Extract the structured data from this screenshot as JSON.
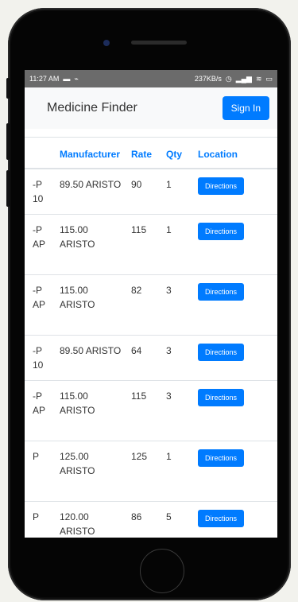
{
  "statusbar": {
    "time": "11:27 AM",
    "speed": "237KB/s"
  },
  "navbar": {
    "brand": "Medicine Finder",
    "signin_label": "Sign In"
  },
  "table": {
    "headers": {
      "name": "",
      "manufacturer": "Manufacturer",
      "rate": "Rate",
      "qty": "Qty",
      "location": "Location"
    },
    "button_label": "Directions",
    "rows": [
      {
        "name_line1": "P-",
        "name_line2": "10",
        "manufacturer": "89.50 ARISTO",
        "rate": "90",
        "qty": "1"
      },
      {
        "name_line1": "P-",
        "name_line2": "AP",
        "manufacturer": "115.00 ARISTO",
        "rate": "115",
        "qty": "1"
      },
      {
        "name_line1": "P-",
        "name_line2": "AP",
        "manufacturer": "115.00 ARISTO",
        "rate": "82",
        "qty": "3"
      },
      {
        "name_line1": "P-",
        "name_line2": "10",
        "manufacturer": "89.50 ARISTO",
        "rate": "64",
        "qty": "3"
      },
      {
        "name_line1": "P-",
        "name_line2": "AP",
        "manufacturer": "115.00 ARISTO",
        "rate": "115",
        "qty": "3"
      },
      {
        "name_line1": "P",
        "name_line2": "",
        "manufacturer": "125.00 ARISTO",
        "rate": "125",
        "qty": "1"
      },
      {
        "name_line1": "P",
        "name_line2": "",
        "manufacturer": "120.00 ARISTO",
        "rate": "86",
        "qty": "5"
      }
    ]
  }
}
